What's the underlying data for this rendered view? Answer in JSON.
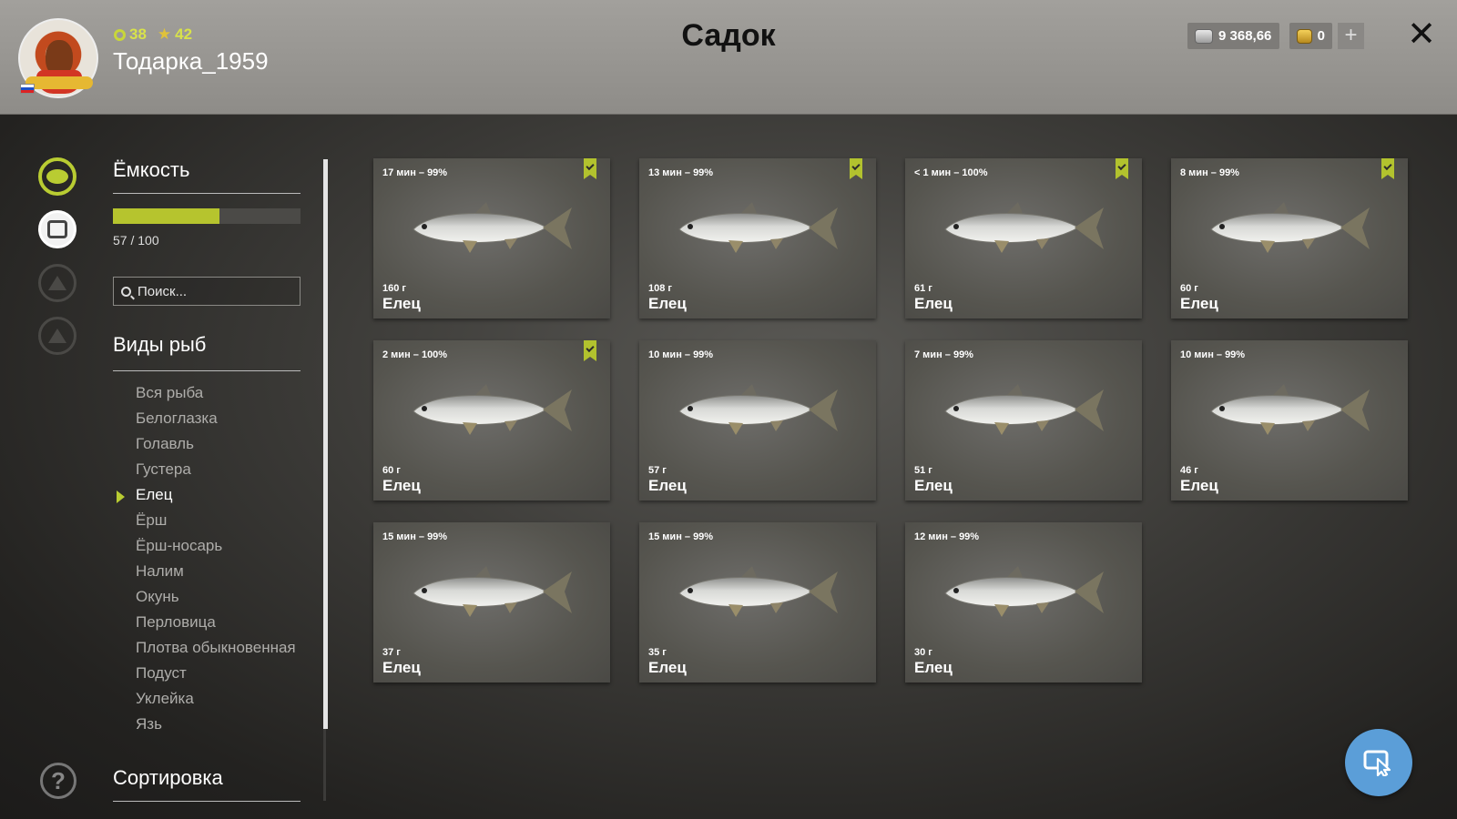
{
  "player": {
    "level": "38",
    "rating": "42",
    "username": "Тодарка_1959"
  },
  "header": {
    "title": "Садок",
    "silver": "9 368,66",
    "gold": "0",
    "plus": "+",
    "close": "✕"
  },
  "capacity": {
    "title": "Ёмкость",
    "current": 57,
    "max": 100,
    "text": "57 / 100"
  },
  "search": {
    "placeholder": "Поиск..."
  },
  "species": {
    "title": "Виды рыб",
    "items": [
      "Вся рыба",
      "Белоглазка",
      "Голавль",
      "Густера",
      "Елец",
      "Ёрш",
      "Ёрш-носарь",
      "Налим",
      "Окунь",
      "Перловица",
      "Плотва обыкновенная",
      "Подуст",
      "Уклейка",
      "Язь"
    ],
    "selected_index": 4
  },
  "sorting": {
    "title": "Сортировка"
  },
  "help": {
    "label": "?"
  },
  "fish": [
    {
      "time": "17 мин – 99%",
      "weight": "160 г",
      "name": "Елец",
      "bookmarked": true
    },
    {
      "time": "13 мин – 99%",
      "weight": "108 г",
      "name": "Елец",
      "bookmarked": true
    },
    {
      "time": "< 1 мин – 100%",
      "weight": "61 г",
      "name": "Елец",
      "bookmarked": true
    },
    {
      "time": "8 мин – 99%",
      "weight": "60 г",
      "name": "Елец",
      "bookmarked": true
    },
    {
      "time": "2 мин – 100%",
      "weight": "60 г",
      "name": "Елец",
      "bookmarked": true
    },
    {
      "time": "10 мин – 99%",
      "weight": "57 г",
      "name": "Елец",
      "bookmarked": false
    },
    {
      "time": "7 мин – 99%",
      "weight": "51 г",
      "name": "Елец",
      "bookmarked": false
    },
    {
      "time": "10 мин – 99%",
      "weight": "46 г",
      "name": "Елец",
      "bookmarked": false
    },
    {
      "time": "15 мин – 99%",
      "weight": "37 г",
      "name": "Елец",
      "bookmarked": false
    },
    {
      "time": "15 мин – 99%",
      "weight": "35 г",
      "name": "Елец",
      "bookmarked": false
    },
    {
      "time": "12 мин – 99%",
      "weight": "30 г",
      "name": "Елец",
      "bookmarked": false
    }
  ],
  "colors": {
    "accent": "#b9cc32",
    "fab": "#5b9ed8"
  },
  "icons": {
    "rail": [
      "fish-icon",
      "keepnet-icon",
      "tent-icon",
      "home-icon"
    ],
    "fab": "cursor-pointer-icon"
  }
}
